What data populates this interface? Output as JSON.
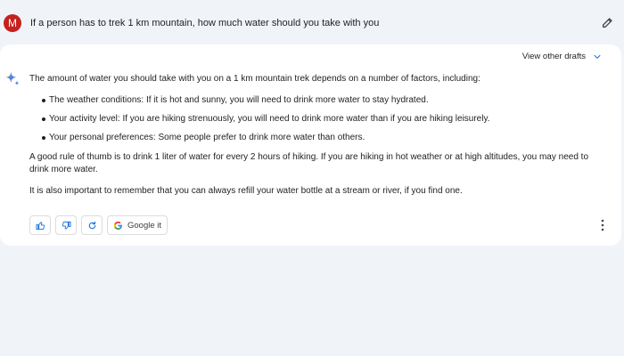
{
  "prompt": {
    "avatar_letter": "M",
    "text": "If a person has to trek 1 km mountain, how much water should you take with you"
  },
  "response": {
    "view_drafts_label": "View other drafts",
    "intro": "The amount of water you should take with you on a 1 km mountain trek depends on a number of factors, including:",
    "bullets": [
      "The weather conditions: If it is hot and sunny, you will need to drink more water to stay hydrated.",
      "Your activity level: If you are hiking strenuously, you will need to drink more water than if you are hiking leisurely.",
      "Your personal preferences: Some people prefer to drink more water than others."
    ],
    "paragraph2": "A good rule of thumb is to drink 1 liter of water for every 2 hours of hiking. If you are hiking in hot weather or at high altitudes, you may need to drink more water.",
    "paragraph3": "It is also important to remember that you can always refill your water bottle at a stream or river, if you find one."
  },
  "actions": {
    "google_label": "Google it"
  },
  "icons": {
    "edit": "pencil-icon",
    "sparkle": "sparkle-icon",
    "thumbs_up": "thumbs-up-icon",
    "thumbs_down": "thumbs-down-icon",
    "regenerate": "refresh-icon",
    "google": "google-g-icon",
    "more": "more-vert-icon",
    "chevron": "chevron-down-icon"
  },
  "colors": {
    "background": "#f0f4f9",
    "card": "#ffffff",
    "avatar": "#c5221f",
    "link_blue": "#1a73e8"
  }
}
